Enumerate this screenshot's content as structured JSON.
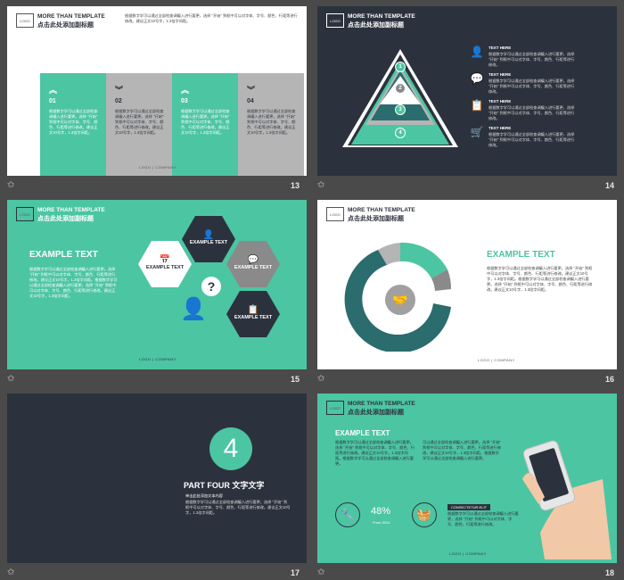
{
  "common": {
    "logo": "LOGO",
    "header_en": "MORE THAN TEMPLATE",
    "header_cn": "点击此处添加副标题",
    "footer": "LOGO  |  COMPANY",
    "star": "✩",
    "body_text": "根据数字学可以通过全部检查调编入进行要更，选择 \"开始\" 到框中可以对字体、字号、颜色、行距等进行修改。建议正文10号字，1.3倍字间距。"
  },
  "slide13": {
    "number": "13",
    "columns": [
      {
        "num": "01",
        "text": "根据数字学可以通过全部检查调编入进行要更。选择 \"开始\" 到框中可以对字体、字号、颜色、行距等进行修改。建议正文10号字，1.3倍字间距。"
      },
      {
        "num": "02",
        "text": "根据数字学可以通过全部检查调编入进行要更。选择 \"开始\" 到框中可以对字体、字号、颜色、行距等进行修改。建议正文10号字，1.3倍字间距。"
      },
      {
        "num": "03",
        "text": "根据数字学可以通过全部检查调编入进行要更。选择 \"开始\" 到框中可以对字体、字号、颜色、行距等进行修改。建议正文10号字，1.3倍字间距。"
      },
      {
        "num": "04",
        "text": "根据数字学可以通过全部检查调编入进行要更。选择 \"开始\" 到框中可以对字体、字号、颜色、行距等进行修改。建议正文10号字，1.3倍字间距。"
      }
    ]
  },
  "slide14": {
    "number": "14",
    "levels": [
      "1",
      "2",
      "3",
      "4"
    ],
    "items": [
      {
        "icon": "user-icon",
        "title": "TEXT HERE",
        "text": "根据数字学可以通过全部检查调编入进行要更，选择 \"开始\" 到框中可以对字体、字号、颜色、行距等进行修改。"
      },
      {
        "icon": "chat-icon",
        "title": "TEXT HERE",
        "text": "根据数字学可以通过全部检查调编入进行要更，选择 \"开始\" 到框中可以对字体、字号、颜色、行距等进行修改。"
      },
      {
        "icon": "clipboard-icon",
        "title": "TEXT HERE",
        "text": "根据数字学可以通过全部检查调编入进行要更，选择 \"开始\" 到框中可以对字体、字号、颜色、行距等进行修改。"
      },
      {
        "icon": "cart-icon",
        "title": "TEXT HERE",
        "text": "根据数字学可以通过全部检查调编入进行要更，选择 \"开始\" 到框中可以对字体、字号、颜色、行距等进行修改。"
      }
    ]
  },
  "slide15": {
    "number": "15",
    "title": "EXAMPLE TEXT",
    "text": "根据数字学可以通过全部检查调编入进行要更。选择 \"开始\" 到框中可以对字体、字号、颜色、行距等进行修改。建议正文10号字，1.3倍字间距。根据数字学可以通过全部检查调编入进行要更。选择 \"开始\" 到框中可以对字体、字号、颜色、行距等进行修改。建议正文10号字，1.3倍字间距。",
    "hex_labels": [
      "EXAMPLE TEXT",
      "EXAMPLE TEXT",
      "EXAMPLE TEXT",
      "EXAMPLE TEXT"
    ]
  },
  "slide16": {
    "number": "16",
    "title": "EXAMPLE TEXT",
    "text": "根据数字学可以通过全部检查调编入进行要更。选择 \"开始\" 到框中可以对字体、字号、颜色、行距等进行修改。建议正文10号字，1.3倍字间距。根据数字学可以通过全部检查调编入进行要更。选择 \"开始\" 到框中可以对字体、字号、颜色、行距等进行修改。建议正文10号字，1.3倍字间距。"
  },
  "slide17": {
    "number": "17",
    "big_number": "4",
    "part_en": "PART FOUR",
    "part_cn": "文字文字",
    "line1": "单击此处添加文本内容",
    "text": "根据数字学可以通过全部检查调编入进行要更，选择 \"开始\" 到框中可以对字体、字号、颜色、行距等进行修改。建议正文10号字，1.3倍字间距。"
  },
  "slide18": {
    "number": "18",
    "title": "EXAMPLE TEXT",
    "text_left": "根据数字学可以通过全部检查调编入进行要更。选择 \"开始\" 到框中可以对字体、字号、颜色、行距等进行修改。建议正文10号字，1.3倍字间距。根据数字学可以通过全部检查调编入进行要更。",
    "text_right": "可以通过全部检查调编入进行要更。选择 \"开始\" 到框中可以对字体、字号、颜色、行距等进行修改。建议正文10号字，1.3倍字间距。根据数字学可以通过全部检查调编入进行要更。",
    "percent": "48%",
    "percent_sub": "From 2014",
    "tag": "CONSECTETUR ELIT",
    "tag_text": "根据数字学可以通过全部检查调编入进行要更，选择 \"开始\" 到框中可以对字体、字号、颜色、行距等进行修改。"
  },
  "colors": {
    "accent": "#4cc5a2",
    "dark": "#2c323d",
    "gray": "#aaaaaa",
    "teal_dark": "#2b6c6e"
  }
}
